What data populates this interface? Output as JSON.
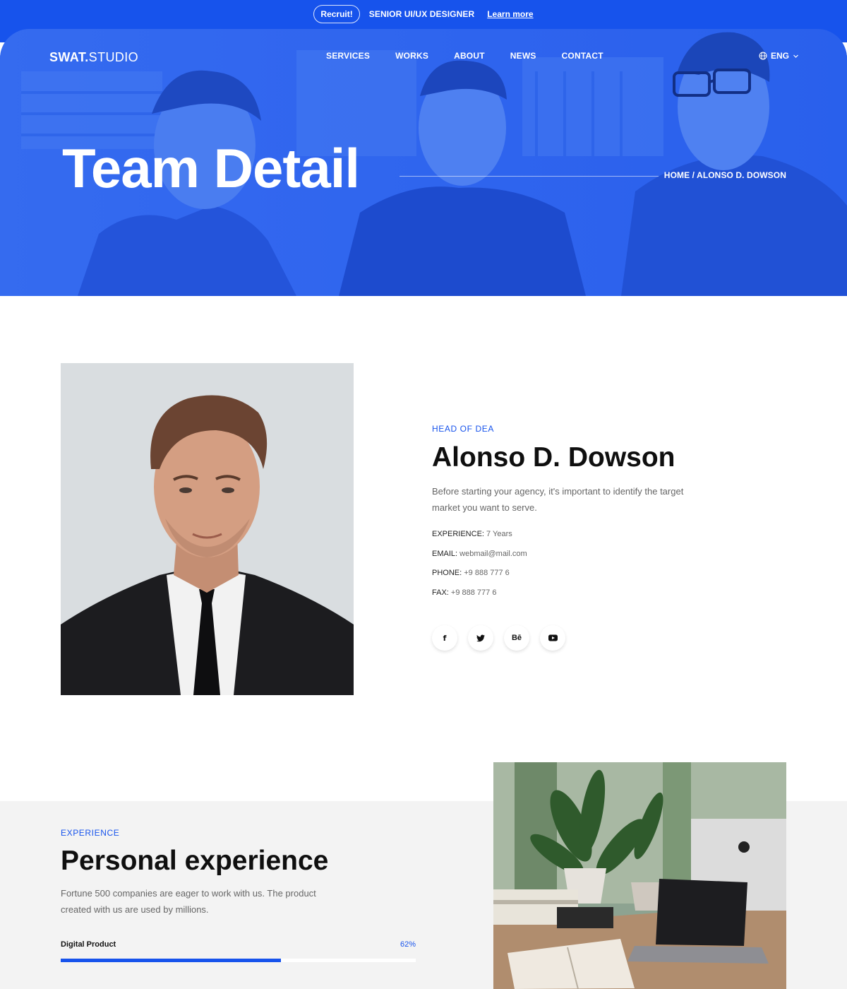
{
  "topbar": {
    "pill": "Recruit!",
    "role": "SENIOR UI/UX DESIGNER",
    "link": "Learn more"
  },
  "header": {
    "logo_bold": "SWAT.",
    "logo_light": "STUDIO",
    "nav": [
      "SERVICES",
      "WORKS",
      "ABOUT",
      "NEWS",
      "CONTACT"
    ],
    "language": "ENG"
  },
  "hero": {
    "title": "Team Detail",
    "breadcrumb": "HOME / ALONSO D. DOWSON"
  },
  "profile": {
    "role": "HEAD OF DEA",
    "name": "Alonso D. Dowson",
    "bio": "Before starting your agency, it's important to identify the target market you want to serve.",
    "details": [
      {
        "label": "EXPERIENCE:",
        "value": "7 Years"
      },
      {
        "label": "EMAIL:",
        "value": "webmail@mail.com"
      },
      {
        "label": "PHONE:",
        "value": "+9 888 777 6"
      },
      {
        "label": "FAX:",
        "value": "+9 888 777 6"
      }
    ],
    "socials": [
      {
        "icon": "facebook-icon",
        "glyph": "f"
      },
      {
        "icon": "twitter-icon",
        "glyph": ""
      },
      {
        "icon": "behance-icon",
        "glyph": "Bē"
      },
      {
        "icon": "youtube-icon",
        "glyph": ""
      }
    ]
  },
  "experience": {
    "tag": "EXPERIENCE",
    "title": "Personal experience",
    "text": "Fortune 500 companies are eager to work with us. The product created with us are used by millions.",
    "skills": [
      {
        "name": "Digital Product",
        "percent_label": "62%",
        "percent": 62
      }
    ]
  },
  "colors": {
    "accent": "#1753ec",
    "hero_overlay": "#2b63ec",
    "section_gray": "#f3f3f3"
  }
}
